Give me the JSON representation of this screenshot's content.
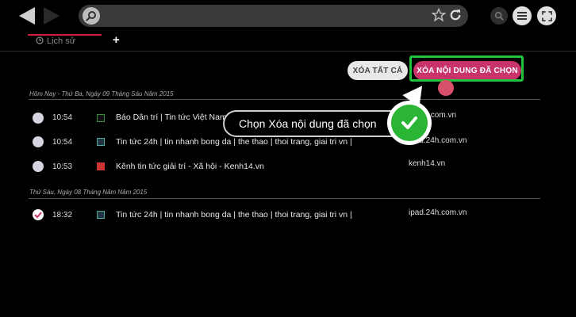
{
  "browser": {
    "url_value": "",
    "icons": [
      "back-icon",
      "forward-icon",
      "search-icon",
      "star-icon",
      "reload-icon",
      "zoom-icon",
      "menu-icon",
      "fullscreen-icon"
    ]
  },
  "tabs": [
    {
      "label": "Lịch sử",
      "icon": "clock-icon"
    }
  ],
  "tab_add_label": "+",
  "actions": {
    "clear_all": "XÓA TẤT CẢ",
    "delete_selected": "XÓA NỘI DUNG ĐÃ CHỌN"
  },
  "tooltip": {
    "text": "Chọn Xóa nội dung đã chọn"
  },
  "history": [
    {
      "header": "Hôm Nay - Thứ Ba, Ngày 09 Tháng Sáu Năm 2015",
      "items": [
        {
          "time": "10:54",
          "title": "Báo Dân trí | Tin tức Việt Nam",
          "domain": "dantri.com.vn",
          "checked": false
        },
        {
          "time": "10:54",
          "title": "Tin tức 24h | tin nhanh bong da | the thao | thoi trang, giai tri vn |",
          "domain": "ipad.24h.com.vn",
          "checked": false
        },
        {
          "time": "10:53",
          "title": "Kênh tin tức giải trí - Xã hội - Kenh14.vn",
          "domain": "kenh14.vn",
          "checked": false
        }
      ]
    },
    {
      "header": "Thứ Sáu, Ngày 08 Tháng Năm Năm 2015",
      "items": [
        {
          "time": "18:32",
          "title": "Tin tức 24h | tin nhanh bong da | the thao | thoi trang, giai tri vn |",
          "domain": "ipad.24h.com.vn",
          "checked": true
        }
      ]
    }
  ],
  "colors": {
    "accent": "#c8336b",
    "highlight": "#22c13a",
    "check": "#2ab534"
  }
}
